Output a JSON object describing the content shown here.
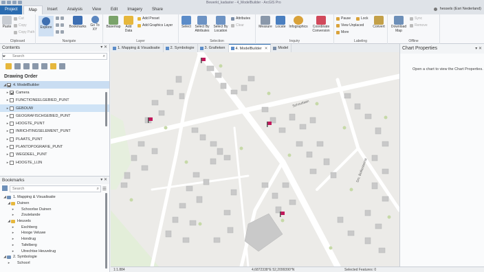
{
  "titlebar": {
    "title": "Bewerkt_kadaster - 4_ModelBuilder - ArcGIS Pro"
  },
  "tabs": [
    "Project",
    "Map",
    "Insert",
    "Analysis",
    "View",
    "Edit",
    "Imagery",
    "Share"
  ],
  "active_tab": "Map",
  "user": {
    "name": "hessels (Esri Nederland)"
  },
  "ribbon": {
    "clipboard": {
      "label": "Clipboard",
      "paste": "Paste",
      "cut": "Cut",
      "copy": "Copy",
      "copy_path": "Copy Path"
    },
    "navigate": {
      "label": "Navigate",
      "explore": "Explore",
      "bookmarks": "Bookmarks",
      "go_to_xy": "Go To XY"
    },
    "layer": {
      "label": "Layer",
      "basemap": "Basemap",
      "add_data": "Add Data",
      "add_preset": "Add Preset",
      "add_graphics_layer": "Add Graphics Layer"
    },
    "selection": {
      "label": "Selection",
      "select": "Select",
      "select_by_attributes": "Select By Attributes",
      "select_by_location": "Select By Location",
      "attributes": "Attributes",
      "clear": "Clear"
    },
    "inquiry": {
      "label": "Inquiry",
      "measure": "Measure",
      "locate": "Locate",
      "infographics": "Infographics",
      "coordinate_conversion": "Coordinate Conversion"
    },
    "labeling": {
      "label": "Labeling",
      "pause": "Pause",
      "lock": "Lock",
      "view_unplaced": "View Unplaced",
      "more": "More",
      "convert": "Convert"
    },
    "offline": {
      "label": "Offline",
      "download_map": "Download Map",
      "sync": "Sync",
      "remove": "Remove"
    }
  },
  "contents": {
    "title": "Contents",
    "search_placeholder": "Search",
    "section": "Drawing Order",
    "items": [
      {
        "label": "4. ModelBuilder",
        "checked": true,
        "level": 0,
        "selected": true
      },
      {
        "label": "Camera",
        "checked": true,
        "level": 1
      },
      {
        "label": "FUNCTIONEELGEBIED_PUNT",
        "checked": false,
        "level": 1
      },
      {
        "label": "GEBOUW",
        "checked": false,
        "level": 1,
        "highlighted": true
      },
      {
        "label": "GEOGRAFISCHGEBIED_PUNT",
        "checked": false,
        "level": 1
      },
      {
        "label": "HOOGTE_PUNT",
        "checked": false,
        "level": 1
      },
      {
        "label": "INRICHTINGSELEMENT_PUNT",
        "checked": false,
        "level": 1
      },
      {
        "label": "PLAATS_PUNT",
        "checked": false,
        "level": 1
      },
      {
        "label": "PLANTOPOGRAFIE_PUNT",
        "checked": false,
        "level": 1
      },
      {
        "label": "WEGDEEL_PUNT",
        "checked": false,
        "level": 1
      },
      {
        "label": "HOOGTE_LIJN",
        "checked": false,
        "level": 1
      }
    ]
  },
  "bookmarks": {
    "title": "Bookmarks",
    "search_placeholder": "Search",
    "items": [
      {
        "label": "1. Mapping & Visualisatie",
        "level": 0,
        "type": "map"
      },
      {
        "label": "Duinen",
        "level": 1,
        "type": "folder"
      },
      {
        "label": "Schoorlse Duinen",
        "level": 2,
        "type": "bookmark"
      },
      {
        "label": "Zoutelande",
        "level": 2,
        "type": "bookmark"
      },
      {
        "label": "Heuvels",
        "level": 1,
        "type": "folder"
      },
      {
        "label": "Eschberg",
        "level": 2,
        "type": "bookmark"
      },
      {
        "label": "Hooge Veluwe",
        "level": 2,
        "type": "bookmark"
      },
      {
        "label": "Hondrug",
        "level": 2,
        "type": "bookmark"
      },
      {
        "label": "Tafelberg",
        "level": 2,
        "type": "bookmark"
      },
      {
        "label": "Utrechtse Heuvelrug",
        "level": 2,
        "type": "bookmark"
      },
      {
        "label": "2. Symbologie",
        "level": 0,
        "type": "map"
      },
      {
        "label": "Schoorl",
        "level": 1,
        "type": "bookmark"
      }
    ]
  },
  "doc_tabs": [
    {
      "label": "1. Mapping & Visualisatie",
      "active": false
    },
    {
      "label": "2. Symbologie",
      "active": false
    },
    {
      "label": "3. Grafieken",
      "active": false
    },
    {
      "label": "4. ModelBuilder",
      "active": true
    },
    {
      "label": "Model",
      "active": false
    }
  ],
  "map": {
    "street_labels": [
      "Schoutlaan",
      "Sm. Bolkesteinst"
    ]
  },
  "chart_properties": {
    "title": "Chart Properties",
    "message": "Open a chart to view the Chart Properties."
  },
  "status": {
    "scale": "1:1.884",
    "coordinates": "4,6872338°E 52,2099390°N",
    "selected_features": "Selected Features: 0"
  },
  "colors": {
    "accent": "#2b6cb0",
    "selection": "#c9ddf2",
    "camera_marker": "#c2185b"
  }
}
